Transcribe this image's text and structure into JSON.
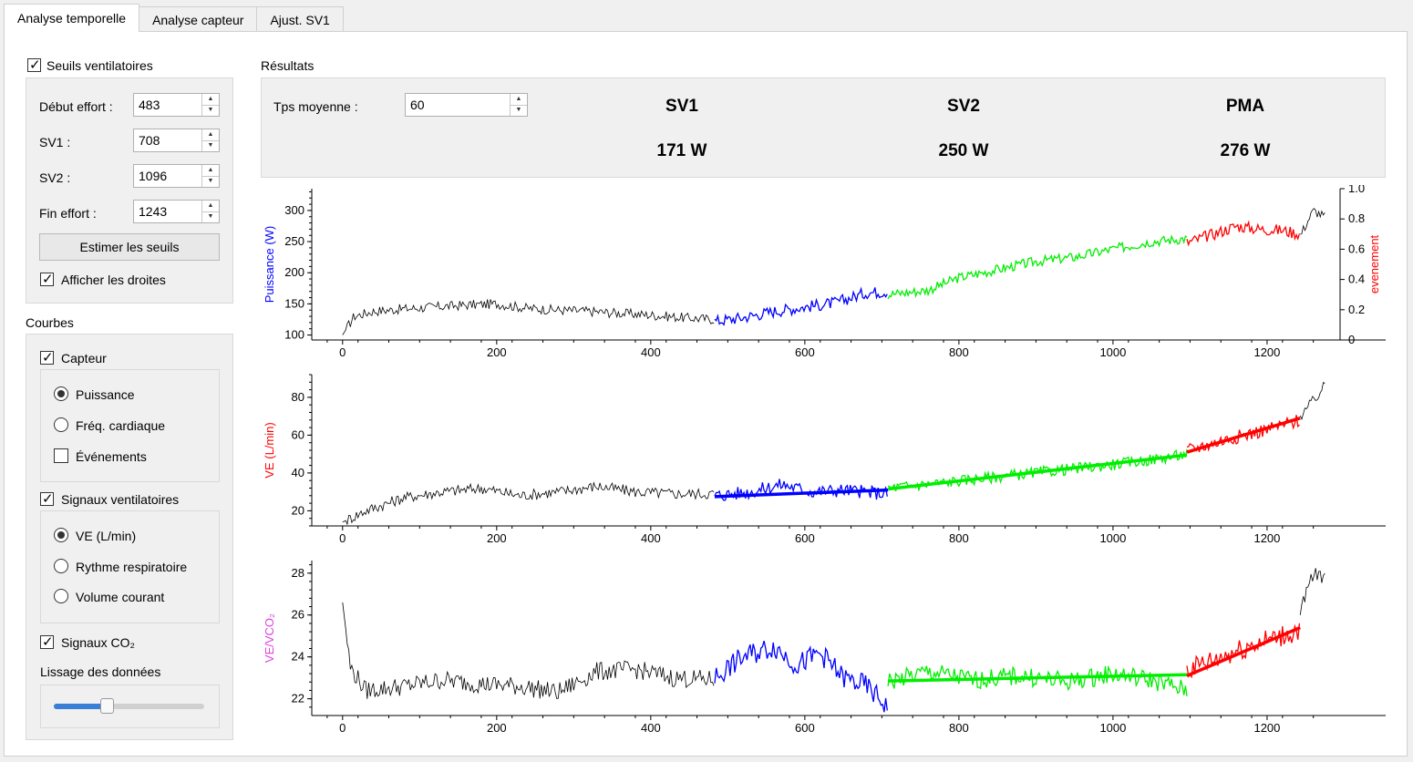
{
  "tabs": [
    "Analyse temporelle",
    "Analyse capteur",
    "Ajust. SV1"
  ],
  "seuils": {
    "title": "Seuils ventilatoires",
    "debut_label": "Début effort :",
    "debut_value": "483",
    "sv1_label": "SV1 :",
    "sv1_value": "708",
    "sv2_label": "SV2 :",
    "sv2_value": "1096",
    "fin_label": "Fin effort :",
    "fin_value": "1243",
    "estimer_button": "Estimer les seuils",
    "afficher_droites": "Afficher les droites"
  },
  "courbes": {
    "title": "Courbes",
    "capteur": "Capteur",
    "puissance": "Puissance",
    "freq": "Fréq. cardiaque",
    "evenements": "Événements",
    "signaux_vent": "Signaux ventilatoires",
    "ve": "VE (L/min)",
    "rythme": "Rythme respiratoire",
    "volume": "Volume courant",
    "signaux_co2": "Signaux CO₂",
    "lissage": "Lissage des données",
    "lissage_level": 0.35
  },
  "resultats": {
    "title": "Résultats",
    "tps_label": "Tps moyenne :",
    "tps_value": "60",
    "sv1_title": "SV1",
    "sv1_value": "171 W",
    "sv2_title": "SV2",
    "sv2_value": "250 W",
    "pma_title": "PMA",
    "pma_value": "276 W"
  },
  "colors": {
    "pre": "#000000",
    "phase1": "#0000ff",
    "phase2": "#00ee00",
    "phase3": "#ff0000",
    "ylabel1": "#0000ff",
    "ylabel1b": "#ff0000",
    "ylabel2": "#ff0000",
    "ylabel3": "#dd44dd"
  },
  "chart_data": [
    {
      "type": "line",
      "ylabel": "Puissance (W)",
      "ylabel_right": "evenement",
      "xlim": [
        -40,
        1290
      ],
      "ylim": [
        92,
        335
      ],
      "ylim_right": [
        0,
        1
      ],
      "xticks": [
        0,
        200,
        400,
        600,
        800,
        1000,
        1200
      ],
      "yticks": [
        100,
        150,
        200,
        250,
        300
      ],
      "yticks_right": [
        0,
        0.2,
        0.4,
        0.6,
        0.8,
        1.0
      ],
      "series": [
        {
          "x": [
            0,
            15,
            40,
            80,
            120,
            160,
            200,
            240,
            280,
            320,
            360,
            400,
            440,
            483
          ],
          "y": [
            100,
            130,
            138,
            142,
            145,
            148,
            150,
            143,
            140,
            138,
            135,
            132,
            128,
            125
          ]
        },
        {
          "x": [
            483,
            520,
            560,
            600,
            640,
            680,
            708
          ],
          "y": [
            122,
            128,
            138,
            145,
            152,
            168,
            170
          ]
        },
        {
          "x": [
            708,
            760,
            800,
            850,
            900,
            950,
            1000,
            1050,
            1096
          ],
          "y": [
            165,
            172,
            192,
            205,
            218,
            225,
            238,
            250,
            255
          ]
        },
        {
          "x": [
            1096,
            1130,
            1160,
            1190,
            1220,
            1243
          ],
          "y": [
            248,
            262,
            275,
            270,
            268,
            262
          ]
        },
        {
          "x": [
            1243,
            1260,
            1275
          ],
          "y": [
            260,
            300,
            290
          ]
        }
      ]
    },
    {
      "type": "line",
      "ylabel": "VE (L/min)",
      "xlim": [
        -40,
        1290
      ],
      "ylim": [
        12,
        92
      ],
      "xticks": [
        0,
        200,
        400,
        600,
        800,
        1000,
        1200
      ],
      "yticks": [
        20,
        40,
        60,
        80
      ],
      "series": [
        {
          "x": [
            0,
            30,
            80,
            130,
            180,
            230,
            280,
            330,
            380,
            430,
            483
          ],
          "y": [
            14,
            20,
            27,
            30,
            32,
            28,
            30,
            33,
            30,
            29,
            29
          ]
        },
        {
          "x": [
            483,
            530,
            570,
            610,
            650,
            708
          ],
          "y": [
            28,
            30,
            34,
            30,
            31,
            29
          ]
        },
        {
          "x": [
            708,
            780,
            850,
            920,
            990,
            1050,
            1096
          ],
          "y": [
            32,
            35,
            38,
            41,
            44,
            47,
            50
          ]
        },
        {
          "x": [
            1096,
            1150,
            1200,
            1243
          ],
          "y": [
            52,
            58,
            63,
            68
          ]
        },
        {
          "x": [
            1243,
            1260,
            1275
          ],
          "y": [
            70,
            78,
            86
          ]
        }
      ],
      "fits": [
        {
          "x": [
            483,
            708
          ],
          "y": [
            27.5,
            31
          ]
        },
        {
          "x": [
            708,
            1096
          ],
          "y": [
            31.5,
            49.5
          ]
        },
        {
          "x": [
            1096,
            1243
          ],
          "y": [
            51,
            69
          ]
        }
      ]
    },
    {
      "type": "line",
      "ylabel": "VE/VCO₂",
      "xlim": [
        -40,
        1290
      ],
      "ylim": [
        21.2,
        28.6
      ],
      "xticks": [
        0,
        200,
        400,
        600,
        800,
        1000,
        1200
      ],
      "yticks": [
        22,
        24,
        26,
        28
      ],
      "series": [
        {
          "x": [
            0,
            10,
            30,
            80,
            130,
            180,
            230,
            280,
            330,
            380,
            430,
            483
          ],
          "y": [
            26.6,
            23.5,
            22.4,
            22.6,
            22.9,
            22.7,
            22.6,
            22.3,
            23.3,
            23.4,
            23.0,
            22.9
          ]
        },
        {
          "x": [
            483,
            520,
            560,
            590,
            620,
            650,
            680,
            708
          ],
          "y": [
            23.0,
            24.0,
            24.5,
            23.6,
            24.2,
            23.0,
            22.6,
            21.6
          ]
        },
        {
          "x": [
            708,
            760,
            820,
            880,
            940,
            1000,
            1050,
            1096
          ],
          "y": [
            22.8,
            23.3,
            22.9,
            23.1,
            22.8,
            23.2,
            22.9,
            22.4
          ]
        },
        {
          "x": [
            1096,
            1140,
            1180,
            1220,
            1243
          ],
          "y": [
            23.4,
            24.0,
            24.6,
            25.0,
            25.3
          ]
        },
        {
          "x": [
            1243,
            1258,
            1275
          ],
          "y": [
            26.0,
            27.8,
            28.0
          ]
        }
      ],
      "fits": [
        {
          "x": [
            708,
            1096
          ],
          "y": [
            22.85,
            23.15
          ]
        },
        {
          "x": [
            1096,
            1243
          ],
          "y": [
            23.1,
            25.4
          ]
        }
      ]
    }
  ]
}
